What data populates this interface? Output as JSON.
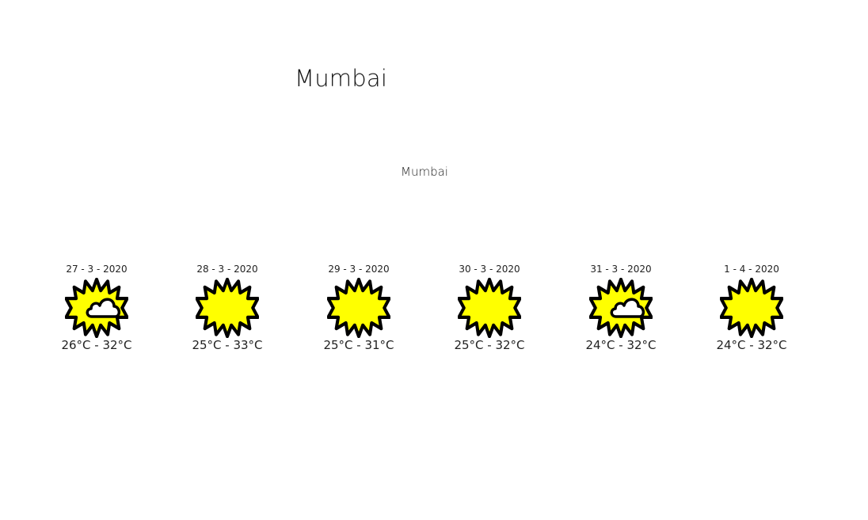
{
  "header": {
    "title": "Mumbai"
  },
  "city": {
    "name": "Mumbai"
  },
  "forecast": [
    {
      "date": "27 - 3 - 2020",
      "temp": "26°C - 32°C",
      "icon": "partly-cloudy-icon"
    },
    {
      "date": "28 - 3 - 2020",
      "temp": "25°C - 33°C",
      "icon": "sun-icon"
    },
    {
      "date": "29 - 3 - 2020",
      "temp": "25°C - 31°C",
      "icon": "sun-icon"
    },
    {
      "date": "30 - 3 - 2020",
      "temp": "25°C - 32°C",
      "icon": "sun-icon"
    },
    {
      "date": "31 - 3 - 2020",
      "temp": "24°C - 32°C",
      "icon": "partly-cloudy-icon"
    },
    {
      "date": "1 - 4 - 2020",
      "temp": "24°C - 32°C",
      "icon": "sun-icon"
    }
  ],
  "colors": {
    "sun_fill": "#ffff00",
    "outline": "#000000",
    "cloud": "#ffffff"
  }
}
